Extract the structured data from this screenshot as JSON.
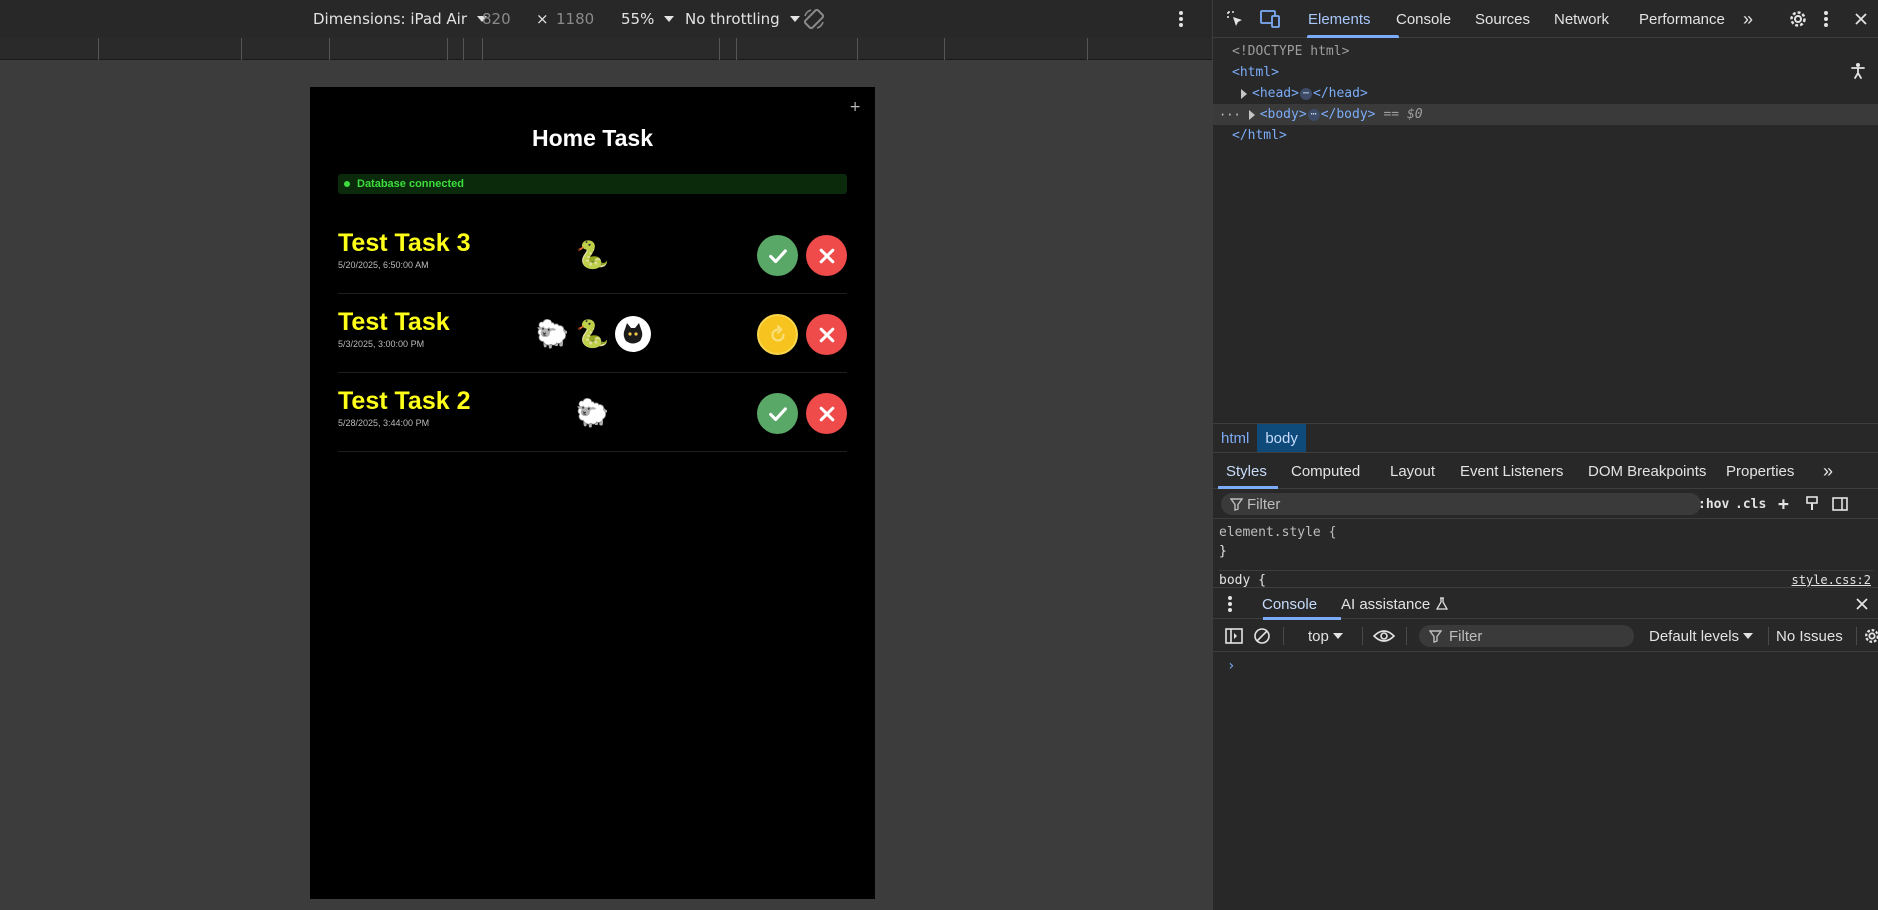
{
  "emulation_toolbar": {
    "device_label": "Dimensions: iPad Air",
    "width": "820",
    "times": "×",
    "height": "1180",
    "zoom": "55%",
    "throttling": "No throttling"
  },
  "app": {
    "plus": "+",
    "title": "Home Task",
    "db_status": "Database connected",
    "tasks": [
      {
        "name": "Test Task 3",
        "date": "5/20/2025, 6:50:00 AM",
        "animals": [
          "snake"
        ],
        "status": "done"
      },
      {
        "name": "Test Task",
        "date": "5/3/2025, 3:00:00 PM",
        "animals": [
          "sheep",
          "snake",
          "cat"
        ],
        "status": "redo"
      },
      {
        "name": "Test Task 2",
        "date": "5/28/2025, 3:44:00 PM",
        "animals": [
          "sheep"
        ],
        "status": "done"
      }
    ]
  },
  "devtools": {
    "tabs": [
      "Elements",
      "Console",
      "Sources",
      "Network",
      "Performance"
    ],
    "more": "»",
    "dom": {
      "doctype": "<!DOCTYPE html>",
      "html_open": "<html>",
      "head_open": "<head>",
      "head_close": "</head>",
      "body_open": "<body>",
      "body_close": "</body>",
      "eq": "== $0",
      "html_close": "</html>",
      "ellipsis": "⋯"
    },
    "breadcrumb": [
      "html",
      "body"
    ],
    "styles_tabs": [
      "Styles",
      "Computed",
      "Layout",
      "Event Listeners",
      "DOM Breakpoints",
      "Properties"
    ],
    "filter_placeholder": "Filter",
    "hov": ":hov",
    "cls": ".cls",
    "element_style": "element.style {",
    "close_brace": "}",
    "body_rule": "body {",
    "source": "style.css:2",
    "drawer_tabs": [
      "Console",
      "AI assistance"
    ],
    "console": {
      "context": "top",
      "filter_placeholder": "Filter",
      "levels": "Default levels",
      "issues": "No Issues",
      "prompt": "›"
    }
  },
  "colors": {
    "task_name": "#ffff1a",
    "db_green": "#3ddc3d",
    "done_button": "#5aa867",
    "delete_button": "#ef4b4b",
    "redo_button": "#f6c31f",
    "accent_blue": "#7cacf8"
  }
}
